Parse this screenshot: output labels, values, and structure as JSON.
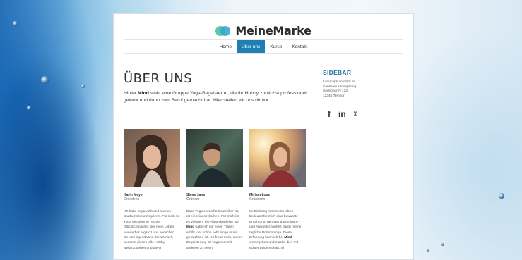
{
  "brand": {
    "name": "MeineMarke"
  },
  "nav": {
    "items": [
      {
        "label": "Home",
        "active": false
      },
      {
        "label": "Über uns",
        "active": true
      },
      {
        "label": "Kurse",
        "active": false
      },
      {
        "label": "Kontakt",
        "active": false
      }
    ]
  },
  "main": {
    "title": "ÜBER UNS",
    "intro_before": "Hinter ",
    "intro_bold": "Mind",
    "intro_after": " steht eine Gruppe Yoga-Begeisterter, die ihr Hobby zunächst professionell gelernt und dann zum Beruf gemacht hat. Hier stellen wir uns dir vor."
  },
  "team": [
    {
      "name": "Karin Meyer",
      "role": "Gründerin",
      "bio": "Ich habe Yoga während meines Studiums kennengelernt. Für mich ist Yoga seit dem ein echter Glücklichmacher, der mein Leben wunderbar ergänzt und bereichert. So kam irgendwann der Wunsch, anderen dieses tolle Hobby weiterzugeben und davon"
    },
    {
      "name": "Steve Jans",
      "role": "Gründer",
      "bio_before": "Dass Yoga etwas für Esoteriker ist, ist ein reines Klischee. Für mich ist es vielmehr ein Alltagsbegleiter. Mit ",
      "bio_bold": "Mind",
      "bio_after": " habe ich mir einen Traum erfüllt, der schon sehr lange in mir gewachsen ist. Ich freue mich, meine Begeisterung für Yoga nun mit anderen zu teilen!"
    },
    {
      "name": "Miriam Lose",
      "role": "Gründerin",
      "bio_before": "Im Einklang mit sich zu leben bedeutet für mich eine bewusste Ernährung, genügend Erholung – und Ausgeglichenheit durch meine tägliche Portion Yoga. Diese Erfahrung kann ich bei ",
      "bio_bold": "Mind",
      "bio_after": " weitergeben und mache dies mit echter Leidenschaft. Ich"
    }
  ],
  "sidebar": {
    "title": "SIDEBAR",
    "lines": [
      "Lorem ipsum dolor sit",
      "Consetetur sadipscing",
      "Sednonumy 123",
      "12345 Tempor"
    ],
    "social": [
      "f",
      "in",
      "ᵡ"
    ]
  },
  "colors": {
    "accent": "#1f7fb5",
    "sidebar_title": "#1f6fa5"
  }
}
